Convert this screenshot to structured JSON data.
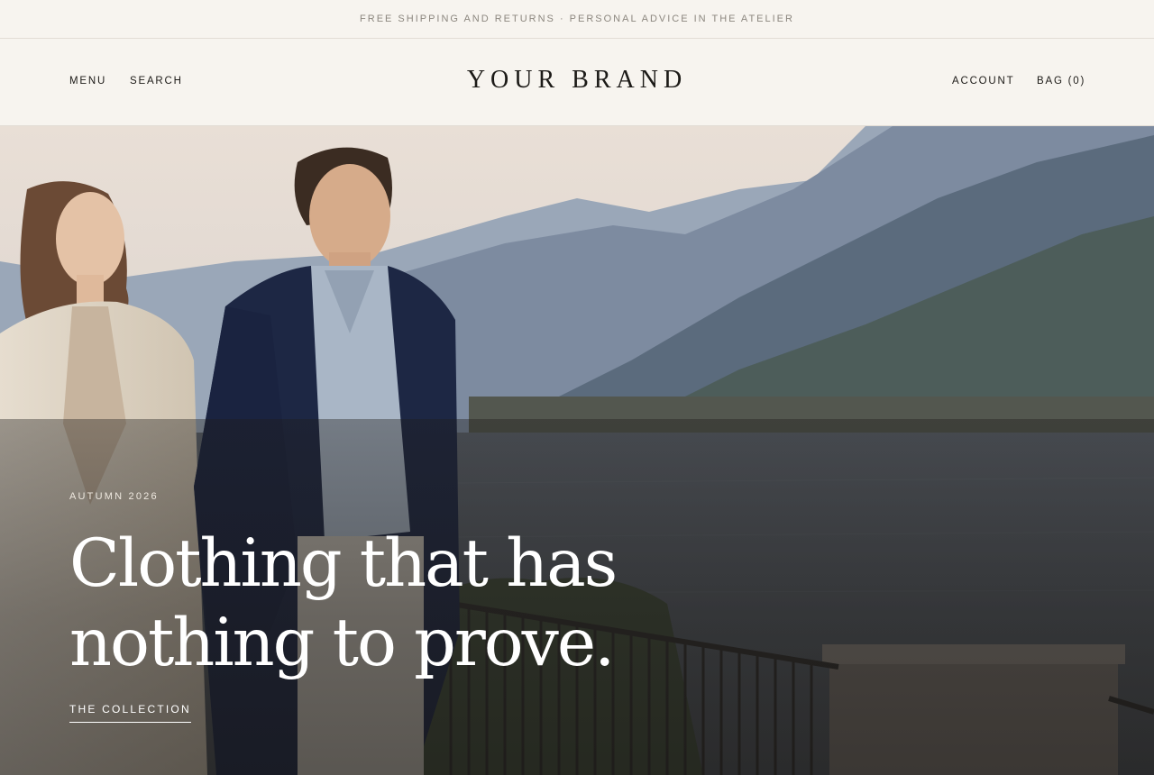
{
  "announcement": {
    "text": "FREE SHIPPING AND RETURNS · PERSONAL ADVICE IN THE ATELIER"
  },
  "header": {
    "menu_label": "MENU",
    "search_label": "SEARCH",
    "brand_name": "YOUR BRAND",
    "account_label": "ACCOUNT",
    "bag_label": "BAG (0)"
  },
  "hero": {
    "eyebrow": "AUTUMN 2026",
    "headline_line1": "Clothing that has",
    "headline_line2": "nothing to prove.",
    "cta_label": "THE COLLECTION"
  },
  "colors": {
    "background": "#f7f4ef",
    "text": "#1c1a17",
    "muted": "#8c877f",
    "hero_text": "#ffffff"
  }
}
